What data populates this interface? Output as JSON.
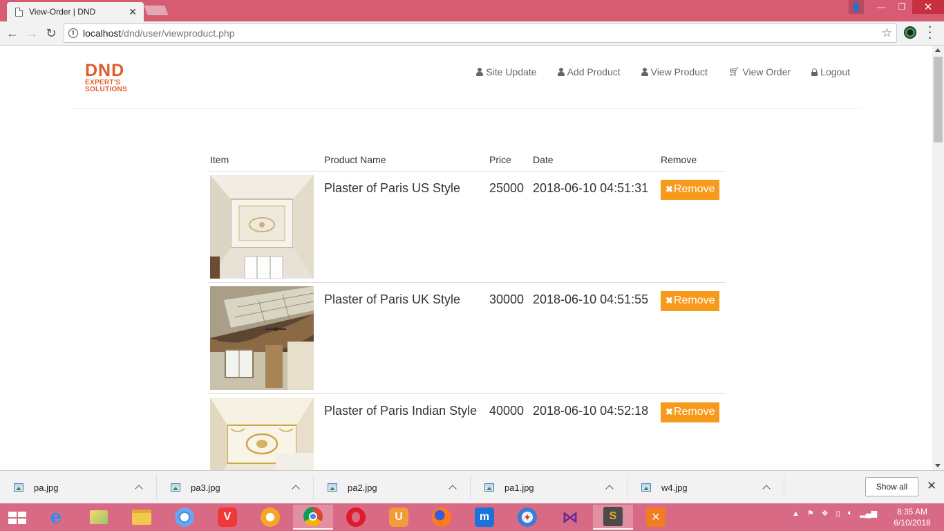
{
  "browser": {
    "tab_title": "View-Order | DND",
    "url_host": "localhost",
    "url_path": "/dnd/user/viewproduct.php"
  },
  "site": {
    "logo_main": "DND",
    "logo_sub1": "EXPERT'S",
    "logo_sub2": "SOLUTIONS",
    "brand_color": "#e05a2a",
    "nav": [
      {
        "label": "Site Update",
        "icon": "user-icon"
      },
      {
        "label": "Add Product",
        "icon": "user-icon"
      },
      {
        "label": "View Product",
        "icon": "user-icon"
      },
      {
        "label": "View Order",
        "icon": "cart-icon"
      },
      {
        "label": "Logout",
        "icon": "lock-icon"
      }
    ]
  },
  "orders": {
    "columns": [
      "Item",
      "Product Name",
      "Price",
      "Date",
      "Remove"
    ],
    "remove_label": "Remove",
    "remove_color": "#f79a1b",
    "rows": [
      {
        "name": "Plaster of Paris US Style",
        "price": "25000",
        "date": "2018-06-10 04:51:31"
      },
      {
        "name": "Plaster of Paris UK Style",
        "price": "30000",
        "date": "2018-06-10 04:51:55"
      },
      {
        "name": "Plaster of Paris Indian Style",
        "price": "40000",
        "date": "2018-06-10 04:52:18"
      }
    ]
  },
  "downloads": {
    "items": [
      "pa.jpg",
      "pa3.jpg",
      "pa2.jpg",
      "pa1.jpg",
      "w4.jpg"
    ],
    "show_all": "Show all"
  },
  "taskbar": {
    "time": "8:35 AM",
    "date": "6/10/2018"
  }
}
